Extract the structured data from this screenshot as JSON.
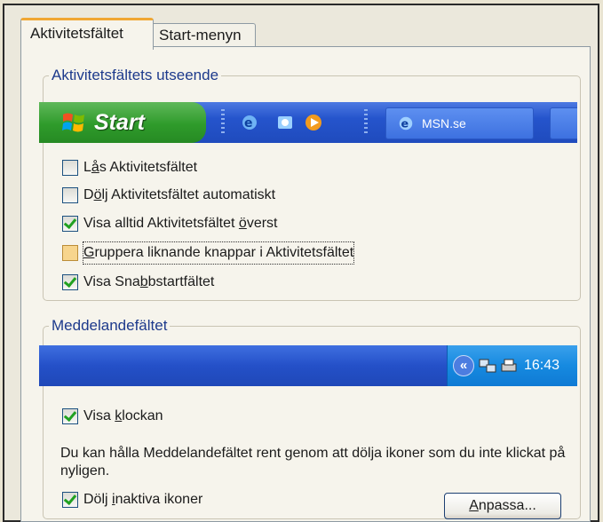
{
  "tabs": [
    {
      "label": "Aktivitetsfältet"
    },
    {
      "label": "Start-menyn"
    }
  ],
  "appearance_group": {
    "title": "Aktivitetsfältets utseende",
    "start_button": "Start",
    "task_button": "MSN.se",
    "options": [
      {
        "pre": "L",
        "key": "å",
        "post": "s Aktivitetsfältet",
        "checked": false
      },
      {
        "pre": "D",
        "key": "ö",
        "post": "lj Aktivitetsfältet automatiskt",
        "checked": false
      },
      {
        "pre": "Visa alltid Aktivitetsfältet ",
        "key": "ö",
        "post": "verst",
        "checked": true
      },
      {
        "pre": "",
        "key": "G",
        "post": "ruppera liknande knappar i Aktivitetsfältet",
        "checked": false
      },
      {
        "pre": "Visa Sna",
        "key": "b",
        "post": "bstartfältet",
        "checked": true
      }
    ]
  },
  "notification_group": {
    "title": "Meddelandefältet",
    "clock_time": "16:43",
    "show_clock": {
      "pre": "Visa ",
      "key": "k",
      "post": "lockan",
      "checked": true
    },
    "description": "Du kan hålla Meddelandefältet rent genom att dölja ikoner som du inte klickat på nyligen.",
    "hide_inactive": {
      "pre": "Dölj ",
      "key": "i",
      "post": "naktiva ikoner",
      "checked": true
    },
    "customize_button": {
      "key": "A",
      "post": "npassa..."
    }
  },
  "colors": {
    "taskbar_blue": "#2554cc",
    "start_green": "#2f9b2b",
    "tray_blue": "#168ae0",
    "checkmark": "#21a121",
    "focus_highlight": "#f7d58d"
  }
}
